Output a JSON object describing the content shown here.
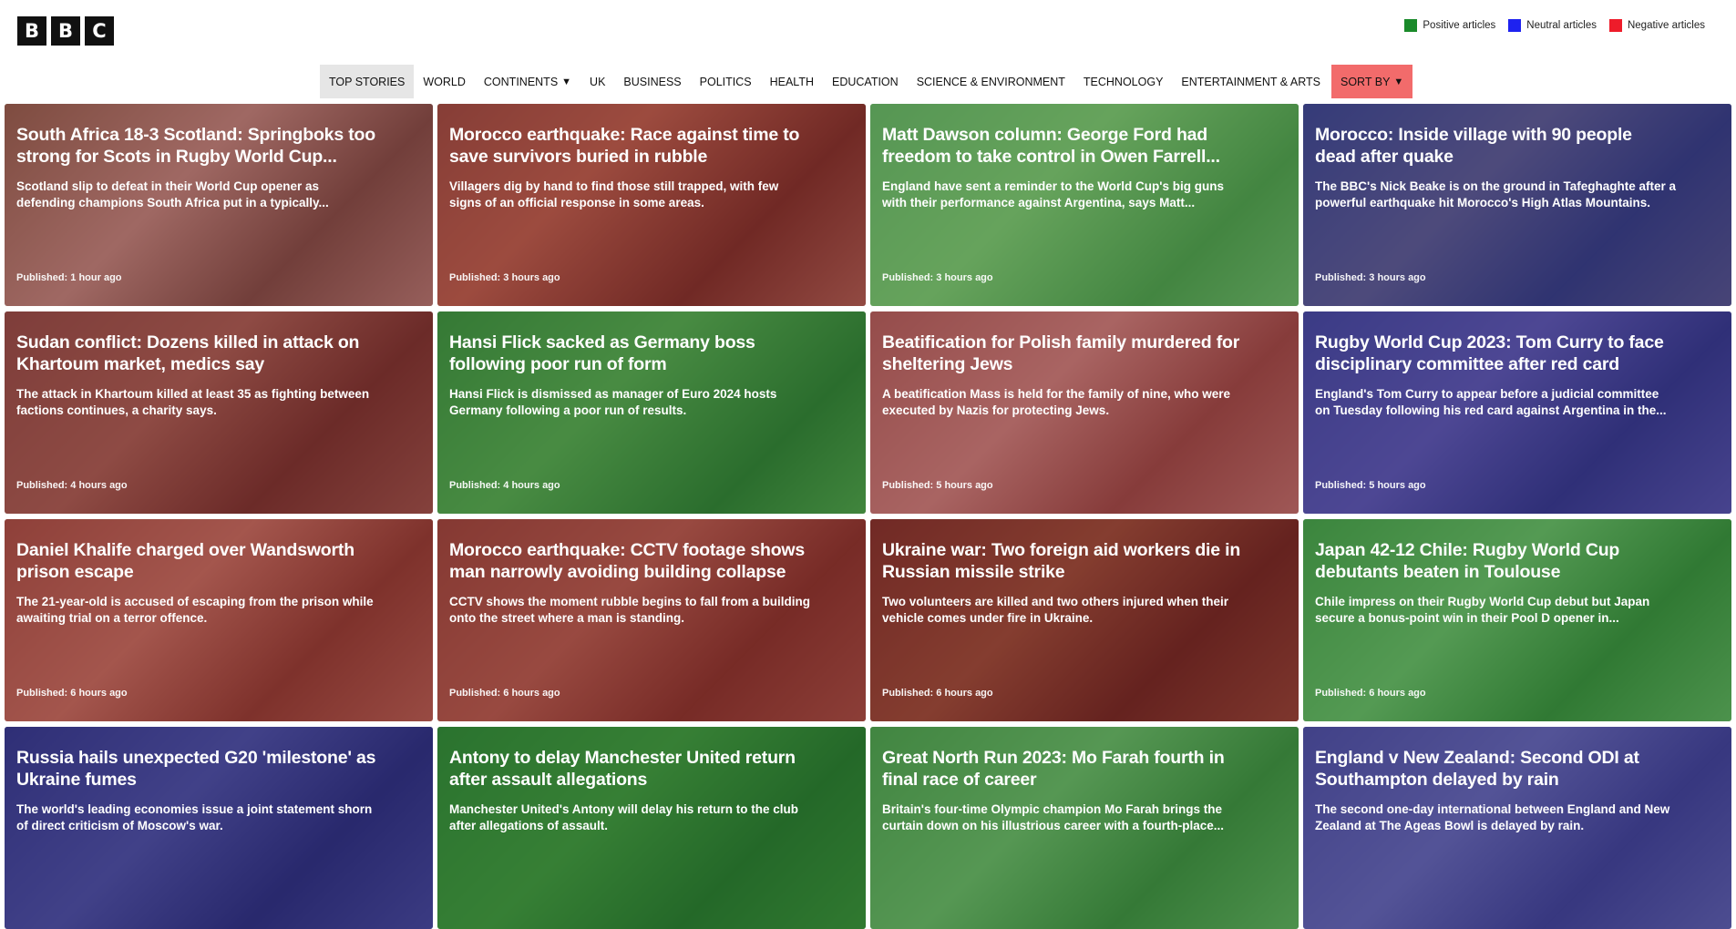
{
  "logo": {
    "letters": [
      "B",
      "B",
      "C"
    ]
  },
  "legend": [
    {
      "label": "Positive articles",
      "color": "#1a8a2a"
    },
    {
      "label": "Neutral articles",
      "color": "#1e22f0"
    },
    {
      "label": "Negative articles",
      "color": "#ee1c2a"
    }
  ],
  "nav": {
    "items": [
      "TOP STORIES",
      "WORLD",
      "CONTINENTS",
      "UK",
      "BUSINESS",
      "POLITICS",
      "HEALTH",
      "EDUCATION",
      "SCIENCE & ENVIRONMENT",
      "TECHNOLOGY",
      "ENTERTAINMENT & ARTS"
    ],
    "sort_label": "SORT BY",
    "caret": "▼"
  },
  "articles": [
    {
      "title": "South Africa 18-3 Scotland: Springboks too strong for Scots in Rugby World Cup...",
      "summary": "Scotland slip to defeat in their World Cup opener as defending champions South Africa put in a typically...",
      "published": "Published: 1 hour ago",
      "sentiment": "negative"
    },
    {
      "title": "Morocco earthquake: Race against time to save survivors buried in rubble",
      "summary": "Villagers dig by hand to find those still trapped, with few signs of an official response in some areas.",
      "published": "Published: 3 hours ago",
      "sentiment": "negative"
    },
    {
      "title": "Matt Dawson column: George Ford had freedom to take control in Owen Farrell...",
      "summary": "England have sent a reminder to the World Cup's big guns with their performance against Argentina, says Matt...",
      "published": "Published: 3 hours ago",
      "sentiment": "positive"
    },
    {
      "title": "Morocco: Inside village with 90 people dead after quake",
      "summary": "The BBC's Nick Beake is on the ground in Tafeghaghte after a powerful earthquake hit Morocco's High Atlas Mountains.",
      "published": "Published: 3 hours ago",
      "sentiment": "neutral"
    },
    {
      "title": "Sudan conflict: Dozens killed in attack on Khartoum market, medics say",
      "summary": "The attack in Khartoum killed at least 35 as fighting between factions continues, a charity says.",
      "published": "Published: 4 hours ago",
      "sentiment": "negative"
    },
    {
      "title": "Hansi Flick sacked as Germany boss following poor run of form",
      "summary": "Hansi Flick is dismissed as manager of Euro 2024 hosts Germany following a poor run of results.",
      "published": "Published: 4 hours ago",
      "sentiment": "positive"
    },
    {
      "title": "Beatification for Polish family murdered for sheltering Jews",
      "summary": "A beatification Mass is held for the family of nine, who were executed by Nazis for protecting Jews.",
      "published": "Published: 5 hours ago",
      "sentiment": "negative"
    },
    {
      "title": "Rugby World Cup 2023: Tom Curry to face disciplinary committee after red card",
      "summary": "England's Tom Curry to appear before a judicial committee on Tuesday following his red card against Argentina in the...",
      "published": "Published: 5 hours ago",
      "sentiment": "neutral"
    },
    {
      "title": "Daniel Khalife charged over Wandsworth prison escape",
      "summary": "The 21-year-old is accused of escaping from the prison while awaiting trial on a terror offence.",
      "published": "Published: 6 hours ago",
      "sentiment": "negative"
    },
    {
      "title": "Morocco earthquake: CCTV footage shows man narrowly avoiding building collapse",
      "summary": "CCTV shows the moment rubble begins to fall from a building onto the street where a man is standing.",
      "published": "Published: 6 hours ago",
      "sentiment": "negative"
    },
    {
      "title": "Ukraine war: Two foreign aid workers die in Russian missile strike",
      "summary": "Two volunteers are killed and two others injured when their vehicle comes under fire in Ukraine.",
      "published": "Published: 6 hours ago",
      "sentiment": "negative"
    },
    {
      "title": "Japan 42-12 Chile: Rugby World Cup debutants beaten in Toulouse",
      "summary": "Chile impress on their Rugby World Cup debut but Japan secure a bonus-point win in their Pool D opener in...",
      "published": "Published: 6 hours ago",
      "sentiment": "positive"
    },
    {
      "title": "Russia hails unexpected G20 'milestone' as Ukraine fumes",
      "summary": "The world's leading economies issue a joint statement shorn of direct criticism of Moscow's war.",
      "published": "",
      "sentiment": "neutral"
    },
    {
      "title": "Antony to delay Manchester United return after assault allegations",
      "summary": "Manchester United's Antony will delay his return to the club after allegations of assault.",
      "published": "",
      "sentiment": "positive"
    },
    {
      "title": "Great North Run 2023: Mo Farah fourth in final race of career",
      "summary": "Britain's four-time Olympic champion Mo Farah brings the curtain down on his illustrious career with a fourth-place...",
      "published": "",
      "sentiment": "positive"
    },
    {
      "title": "England v New Zealand: Second ODI at Southampton delayed by rain",
      "summary": "The second one-day international between England and New Zealand at The Ageas Bowl is delayed by rain.",
      "published": "",
      "sentiment": "neutral"
    }
  ]
}
